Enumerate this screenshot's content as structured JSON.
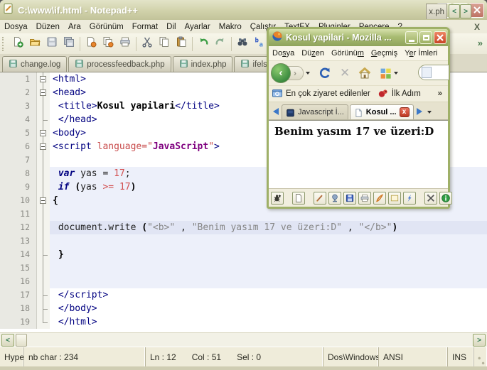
{
  "notepadpp": {
    "title": "C:\\www\\if.html - Notepad++",
    "menu": [
      "Dosya",
      "Düzen",
      "Ara",
      "Görünüm",
      "Format",
      "Dil",
      "Ayarlar",
      "Makro",
      "Çalıştır",
      "TextFX",
      "Pluginler",
      "Pencere",
      "?"
    ],
    "menu_close_glyph": "X",
    "toolbar_icons": [
      "new-file-icon",
      "open-folder-icon",
      "save-icon",
      "save-all-icon",
      "close-doc-icon",
      "close-all-icon",
      "print-icon",
      "cut-icon",
      "copy-icon",
      "paste-icon",
      "undo-icon",
      "redo-icon",
      "find-icon",
      "replace-icon"
    ],
    "toolbar_separators_after": [
      3,
      6,
      9,
      11
    ],
    "toolbar_overflow_glyph": "»",
    "doc_tabs": [
      "change.log",
      "processfeedback.php",
      "index.php",
      "ifelse.php"
    ],
    "doc_tab_fragment": "x.ph",
    "tab_scroll_left": "<",
    "tab_scroll_right": ">",
    "editor": {
      "lines": [
        {
          "n": "1",
          "f": "box",
          "b": "",
          "s": [
            [
              "tag",
              "<html>"
            ]
          ]
        },
        {
          "n": "2",
          "f": "box",
          "b": "",
          "s": [
            [
              "tag",
              "<head>"
            ]
          ]
        },
        {
          "n": "3",
          "f": "line",
          "b": "",
          "s": [
            [
              "def",
              " "
            ],
            [
              "tag",
              "<title>"
            ],
            [
              "txt",
              "Kosul yapilari"
            ],
            [
              "tag",
              "</title>"
            ]
          ]
        },
        {
          "n": "4",
          "f": "tick",
          "b": "",
          "s": [
            [
              "def",
              " "
            ],
            [
              "tag",
              "</head>"
            ]
          ]
        },
        {
          "n": "5",
          "f": "box",
          "b": "",
          "s": [
            [
              "tag",
              "<body>"
            ]
          ]
        },
        {
          "n": "6",
          "f": "box",
          "b": "",
          "s": [
            [
              "tag",
              "<script"
            ],
            [
              "def",
              " "
            ],
            [
              "attr",
              "language"
            ],
            [
              "q",
              "=\""
            ],
            [
              "val",
              "JavaScript"
            ],
            [
              "q",
              "\""
            ],
            [
              "tag",
              ">"
            ]
          ]
        },
        {
          "n": "7",
          "f": "line",
          "b": "",
          "s": []
        },
        {
          "n": "8",
          "f": "line",
          "b": "band",
          "s": [
            [
              "def",
              " "
            ],
            [
              "kw",
              "var"
            ],
            [
              "def",
              " yas = "
            ],
            [
              "num",
              "17"
            ],
            [
              "def",
              ";"
            ]
          ]
        },
        {
          "n": "9",
          "f": "line",
          "b": "band",
          "s": [
            [
              "def",
              " "
            ],
            [
              "kw",
              "if"
            ],
            [
              "def",
              " "
            ],
            [
              "br",
              "("
            ],
            [
              "def",
              "yas "
            ],
            [
              "op",
              ">="
            ],
            [
              "def",
              " "
            ],
            [
              "num",
              "17"
            ],
            [
              "br",
              ")"
            ]
          ]
        },
        {
          "n": "10",
          "f": "box",
          "b": "band",
          "s": [
            [
              "br",
              "{"
            ]
          ]
        },
        {
          "n": "11",
          "f": "line",
          "b": "band",
          "s": []
        },
        {
          "n": "12",
          "f": "line",
          "b": "hl",
          "s": [
            [
              "def",
              " document.write "
            ],
            [
              "br",
              "("
            ],
            [
              "str",
              "\"<b>\""
            ],
            [
              "def",
              " , "
            ],
            [
              "str",
              "\"Benim yasım 17 ve üzeri:D\""
            ],
            [
              "def",
              " , "
            ],
            [
              "str",
              "\"</b>\""
            ],
            [
              "br",
              ")"
            ]
          ]
        },
        {
          "n": "13",
          "f": "line",
          "b": "band",
          "s": []
        },
        {
          "n": "14",
          "f": "tick",
          "b": "band",
          "s": [
            [
              "def",
              " "
            ],
            [
              "br",
              "}"
            ]
          ]
        },
        {
          "n": "15",
          "f": "line",
          "b": "band",
          "s": []
        },
        {
          "n": "16",
          "f": "line",
          "b": "band",
          "s": []
        },
        {
          "n": "17",
          "f": "tick",
          "b": "",
          "s": [
            [
              "def",
              " "
            ],
            [
              "tag",
              "</script>"
            ]
          ]
        },
        {
          "n": "18",
          "f": "tick",
          "b": "",
          "s": [
            [
              "def",
              " "
            ],
            [
              "tag",
              "</body>"
            ]
          ]
        },
        {
          "n": "19",
          "f": "end",
          "b": "",
          "s": [
            [
              "def",
              " "
            ],
            [
              "tag",
              "</html>"
            ]
          ]
        }
      ]
    },
    "statusbar": {
      "doctype_clipped": "Hype",
      "nbchar": "nb char : 234",
      "ln": "Ln : 12",
      "col": "Col : 51",
      "sel": "Sel : 0",
      "eol": "Dos\\Windows",
      "encoding": "ANSI",
      "insert_mode": "INS"
    }
  },
  "firefox": {
    "title": "Kosul yapilari - Mozilla ...",
    "menu": [
      {
        "pre": "Do",
        "acc": "s",
        "post": "ya"
      },
      {
        "pre": "Dü",
        "acc": "z",
        "post": "en"
      },
      {
        "pre": "Görünü",
        "acc": "m",
        "post": ""
      },
      {
        "pre": "",
        "acc": "G",
        "post": "eçmiş"
      },
      {
        "pre": "Y",
        "acc": "e",
        "post": "r İmleri"
      }
    ],
    "toolbar": {
      "back_glyph": "‹",
      "fwd_glyph": "›",
      "stop_glyph": "✕"
    },
    "bookmarks": [
      {
        "icon": "most-visited-folder-icon",
        "label": "En çok ziyaret edilenler"
      },
      {
        "icon": "ilk-adim-icon",
        "label": "İlk Adım"
      }
    ],
    "bookmarks_overflow_glyph": "»",
    "tabs": [
      {
        "icon": "javascript-site-icon",
        "label": "Javascript İ...",
        "active": false,
        "close": ""
      },
      {
        "icon": "page-icon",
        "label": "Kosul ...",
        "active": true,
        "close": "x"
      }
    ],
    "content_text": "Benim yasım 17 ve üzeri:D",
    "addon_buttons": [
      "bug-icon",
      "new-page-icon",
      "edit-pencil-icon",
      "validate-icon",
      "save-blue-icon",
      "print-small-icon",
      "draw-quill-icon",
      "frame-icon",
      "lightning-icon",
      "tools-icon",
      "info-icon"
    ],
    "addon_gaps_before": [
      1,
      2,
      9
    ]
  },
  "colors": {
    "accent_olive": "#8FA35C",
    "close_red": "#C84325",
    "band": "#EDF0FA",
    "current_line": "#E1E5F4"
  }
}
